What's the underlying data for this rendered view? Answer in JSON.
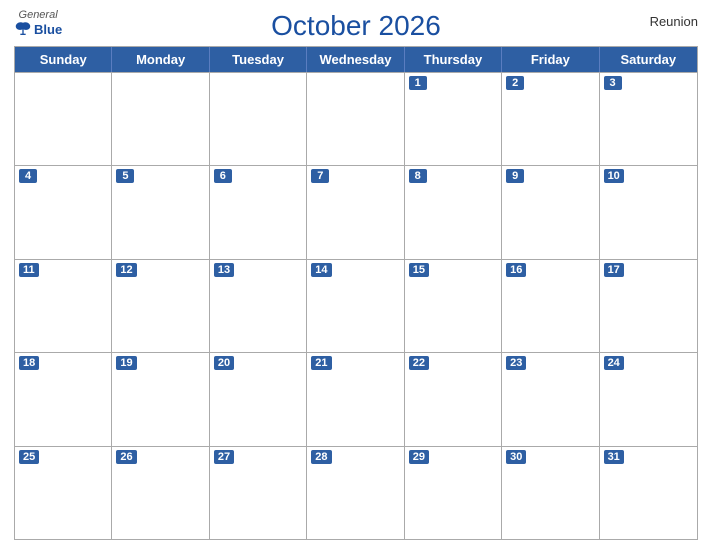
{
  "header": {
    "logo_general": "General",
    "logo_blue": "Blue",
    "title": "October 2026",
    "region": "Reunion"
  },
  "days_of_week": [
    "Sunday",
    "Monday",
    "Tuesday",
    "Wednesday",
    "Thursday",
    "Friday",
    "Saturday"
  ],
  "weeks": [
    [
      {
        "date": "",
        "empty": true
      },
      {
        "date": "",
        "empty": true
      },
      {
        "date": "",
        "empty": true
      },
      {
        "date": "",
        "empty": true
      },
      {
        "date": "1"
      },
      {
        "date": "2"
      },
      {
        "date": "3"
      }
    ],
    [
      {
        "date": "4"
      },
      {
        "date": "5"
      },
      {
        "date": "6"
      },
      {
        "date": "7"
      },
      {
        "date": "8"
      },
      {
        "date": "9"
      },
      {
        "date": "10"
      }
    ],
    [
      {
        "date": "11"
      },
      {
        "date": "12"
      },
      {
        "date": "13"
      },
      {
        "date": "14"
      },
      {
        "date": "15"
      },
      {
        "date": "16"
      },
      {
        "date": "17"
      }
    ],
    [
      {
        "date": "18"
      },
      {
        "date": "19"
      },
      {
        "date": "20"
      },
      {
        "date": "21"
      },
      {
        "date": "22"
      },
      {
        "date": "23"
      },
      {
        "date": "24"
      }
    ],
    [
      {
        "date": "25"
      },
      {
        "date": "26"
      },
      {
        "date": "27"
      },
      {
        "date": "28"
      },
      {
        "date": "29"
      },
      {
        "date": "30"
      },
      {
        "date": "31"
      }
    ]
  ]
}
